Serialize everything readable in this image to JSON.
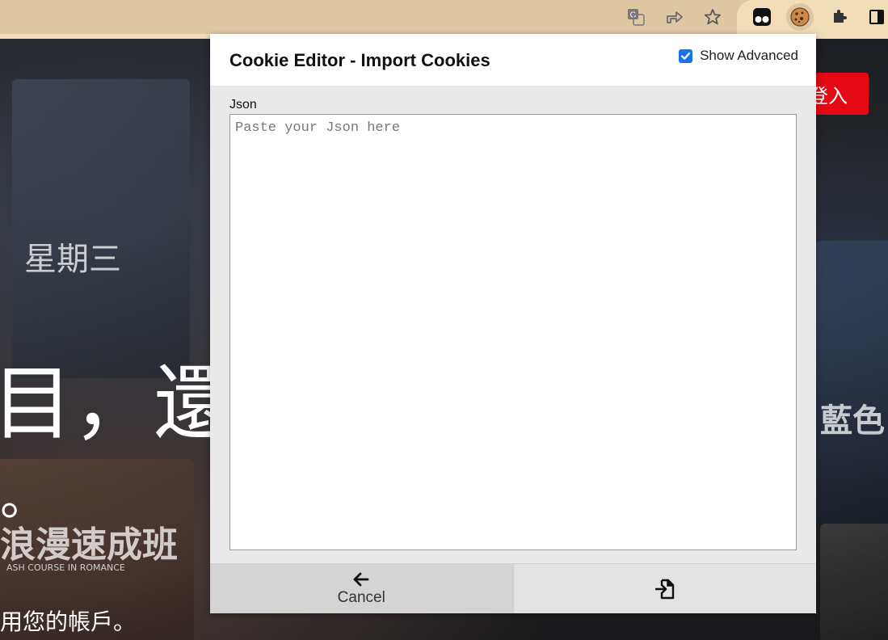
{
  "browser": {
    "toolbar_icons": [
      "translate-icon",
      "share-icon",
      "star-icon",
      "tampermonkey-icon",
      "cookie-icon",
      "puzzle-icon",
      "sidepanel-icon"
    ]
  },
  "background_page": {
    "login_label": "登入",
    "headline": "目，還",
    "headline_tail": "。",
    "subline": "用您的帳戶。",
    "poster_text_1": "星期三",
    "poster_text_2": "浪漫速成班",
    "poster_text_3": "ASH COURSE IN ROMANCE",
    "poster_text_4": "藍色"
  },
  "popup": {
    "title": "Cookie Editor - Import Cookies",
    "show_advanced_label": "Show Advanced",
    "show_advanced_checked": true,
    "json_label": "Json",
    "json_placeholder": "Paste your Json here",
    "json_value": "",
    "cancel_label": "Cancel",
    "cancel_icon": "arrow-left-icon",
    "import_icon": "file-import-icon"
  },
  "colors": {
    "accent": "#1a73e8",
    "login_red": "#e50914",
    "toolbar": "#e0c7a3"
  }
}
